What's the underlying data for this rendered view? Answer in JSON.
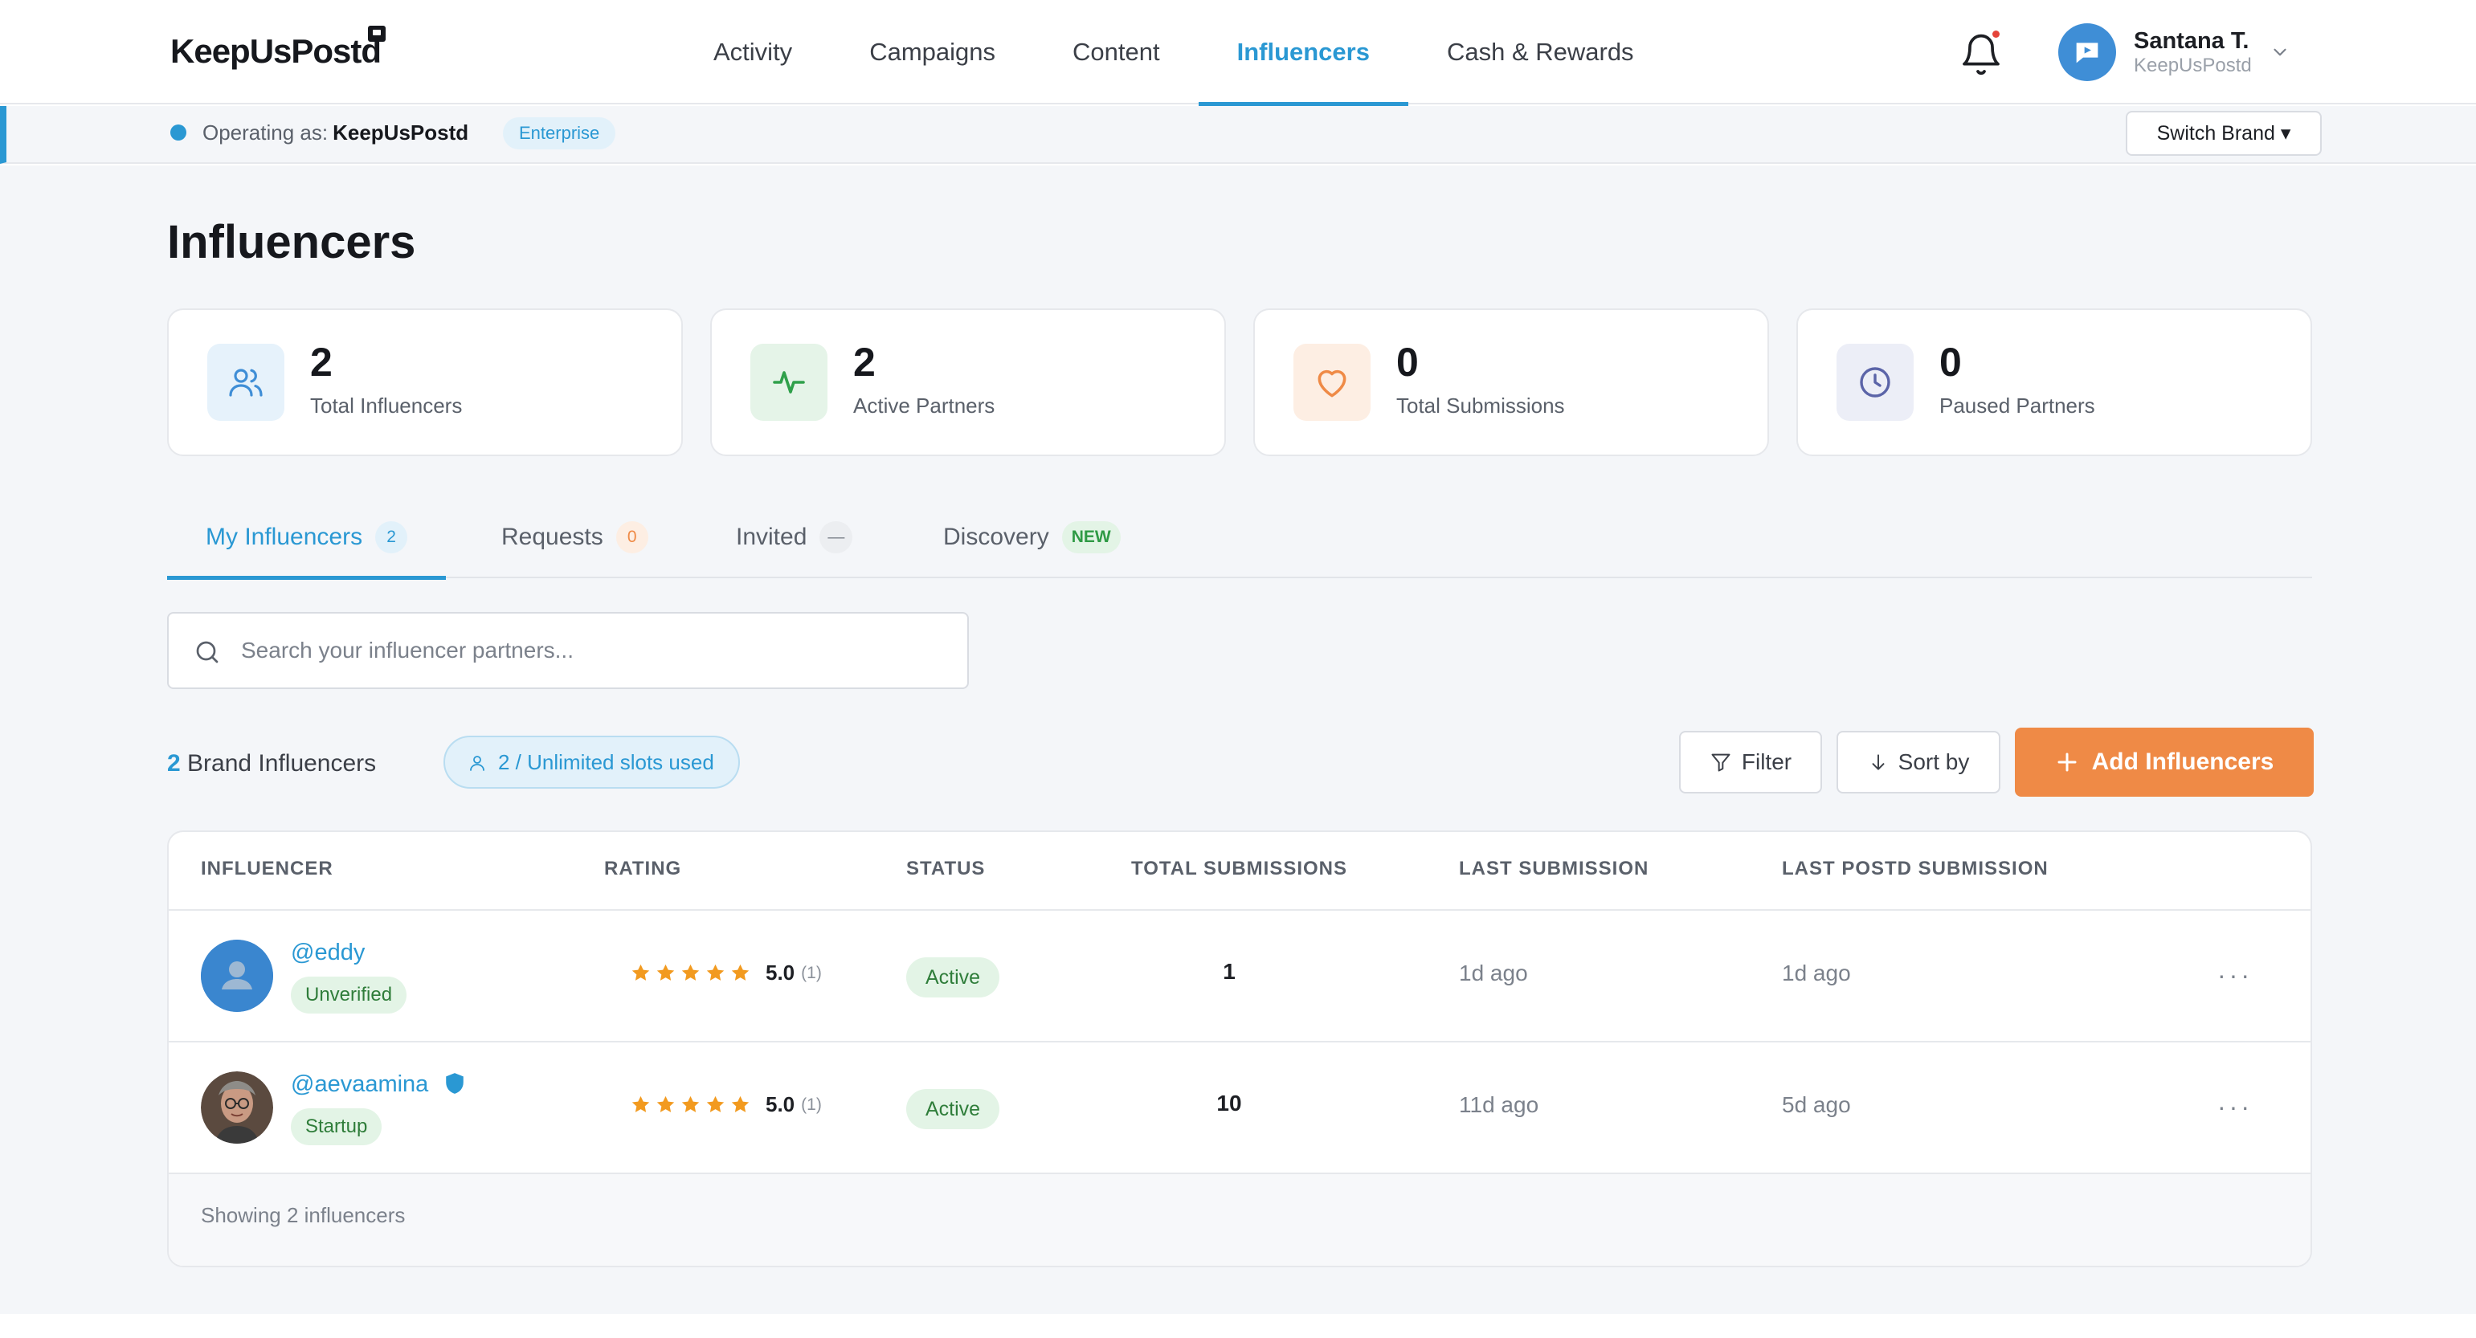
{
  "brand": {
    "logo_text": "KeepUsPostd"
  },
  "nav": {
    "items": [
      {
        "label": "Activity",
        "active": false
      },
      {
        "label": "Campaigns",
        "active": false
      },
      {
        "label": "Content",
        "active": false
      },
      {
        "label": "Influencers",
        "active": true
      },
      {
        "label": "Cash & Rewards",
        "active": false
      }
    ],
    "icons": {
      "notifications": "bell-icon",
      "user_menu": "chevron-down-icon"
    }
  },
  "user": {
    "name": "Santana T.",
    "org": "KeepUsPostd"
  },
  "operating": {
    "label": "Operating as:",
    "brand": "KeepUsPostd",
    "plan_badge": "Enterprise",
    "switch_label": "Switch Brand ▾"
  },
  "page": {
    "title": "Influencers"
  },
  "stats": [
    {
      "value": "2",
      "label": "Total Influencers",
      "icon": "users-icon",
      "color": "#3f8ed6"
    },
    {
      "value": "2",
      "label": "Active Partners",
      "icon": "activity-icon",
      "color": "#2fa04a"
    },
    {
      "value": "0",
      "label": "Total Submissions",
      "icon": "heart-icon",
      "color": "#ef8a46"
    },
    {
      "value": "0",
      "label": "Paused Partners",
      "icon": "clock-icon",
      "color": "#5b64a8"
    }
  ],
  "tabs": [
    {
      "label": "My Influencers",
      "badge": "2",
      "active": true
    },
    {
      "label": "Requests",
      "badge": "0",
      "active": false
    },
    {
      "label": "Invited",
      "badge": "—",
      "active": false
    },
    {
      "label": "Discovery",
      "badge": "NEW",
      "active": false
    }
  ],
  "search": {
    "placeholder": "Search your influencer partners...",
    "value": ""
  },
  "summary": {
    "count": "2",
    "count_label": "Brand Influencers",
    "slots": "2 / Unlimited slots used"
  },
  "toolbar": {
    "filter_label": "Filter",
    "sort_label": "Sort by",
    "add_label": "Add Influencers"
  },
  "table": {
    "columns": [
      "INFLUENCER",
      "RATING",
      "STATUS",
      "TOTAL SUBMISSIONS",
      "LAST SUBMISSION",
      "LAST POSTD SUBMISSION"
    ],
    "rows": [
      {
        "handle": "@eddy",
        "tier": "Unverified",
        "verified": false,
        "rating": "5.0",
        "rating_count": "(1)",
        "stars": 5,
        "status": "Active",
        "total_submissions": "1",
        "last_submission": "1d ago",
        "last_postd_submission": "1d ago"
      },
      {
        "handle": "@aevaamina",
        "tier": "Startup",
        "verified": true,
        "rating": "5.0",
        "rating_count": "(1)",
        "stars": 5,
        "status": "Active",
        "total_submissions": "10",
        "last_submission": "11d ago",
        "last_postd_submission": "5d ago"
      }
    ],
    "footer": "Showing 2 influencers"
  },
  "colors": {
    "accent": "#2a98d3",
    "cta": "#ef8a46",
    "success": "#2f7d3a",
    "star": "#f29a1f"
  }
}
